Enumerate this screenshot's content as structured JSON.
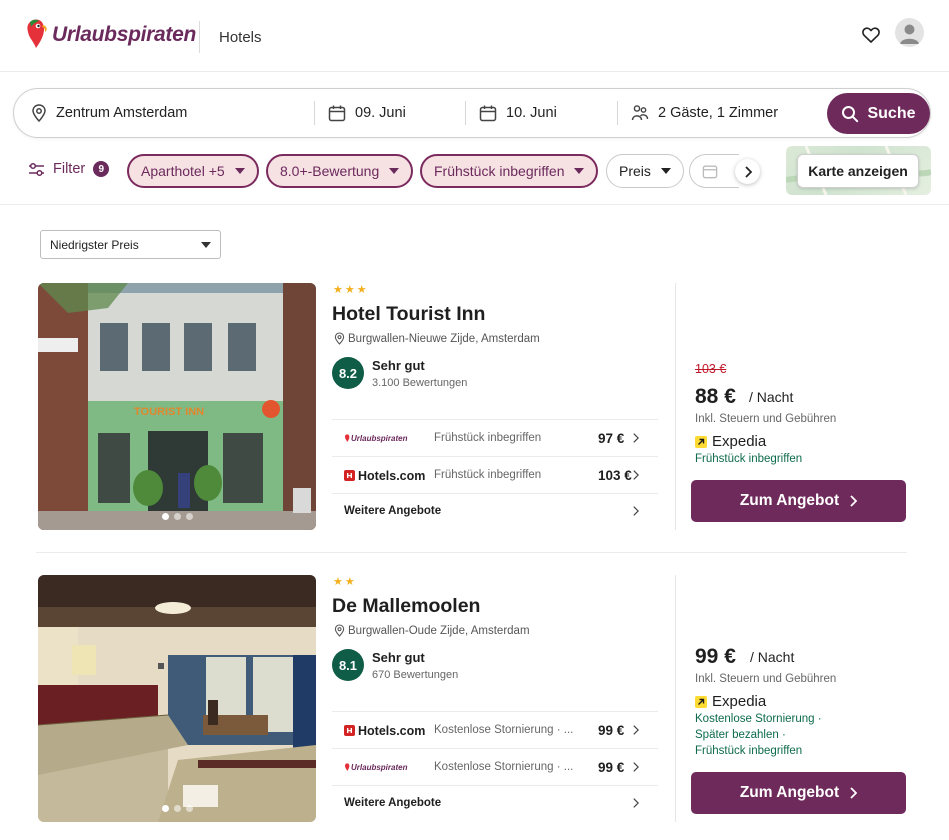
{
  "header": {
    "brand": "Urlaubspiraten",
    "nav_item": "Hotels",
    "favorites_icon": "heart-icon",
    "profile_icon": "user-avatar-icon"
  },
  "search": {
    "destination": "Zentrum Amsterdam",
    "checkin": "09. Juni",
    "checkout": "10. Juni",
    "guests": "2 Gäste, 1 Zimmer",
    "button_label": "Suche"
  },
  "filters": {
    "label": "Filter",
    "count": "9",
    "chips": [
      {
        "label": "Aparthotel +5",
        "active": true
      },
      {
        "label": "8.0+-Bewertung",
        "active": true
      },
      {
        "label": "Frühstück inbegriffen",
        "active": true
      },
      {
        "label": "Preis",
        "active": false
      }
    ],
    "map_button": "Karte anzeigen"
  },
  "sort": {
    "selected": "Niedrigster Preis"
  },
  "hotels": [
    {
      "stars": 3,
      "name": "Hotel Tourist Inn",
      "location": "Burgwallen-Nieuwe Zijde, Amsterdam",
      "rating": "8.2",
      "rating_label": "Sehr gut",
      "reviews": "3.100 Bewertungen",
      "offers": [
        {
          "partner": "Urlaubspiraten",
          "description": "Frühstück inbegriffen",
          "price": "97 €"
        },
        {
          "partner": "Hotels.com",
          "description": "Frühstück inbegriffen",
          "price": "103 €"
        }
      ],
      "more_offers": "Weitere Angebote",
      "old_price": "103 €",
      "price": "88 €",
      "per_night": "/ Nacht",
      "tax_note": "Inkl. Steuern und Gebühren",
      "provider": "Expedia",
      "perks": [
        "Frühstück inbegriffen"
      ],
      "cta": "Zum Angebot"
    },
    {
      "stars": 2,
      "name": "De Mallemoolen",
      "location": "Burgwallen-Oude Zijde, Amsterdam",
      "rating": "8.1",
      "rating_label": "Sehr gut",
      "reviews": "670 Bewertungen",
      "offers": [
        {
          "partner": "Hotels.com",
          "description": "Kostenlose Stornierung · ...",
          "price": "99 €"
        },
        {
          "partner": "Urlaubspiraten",
          "description": "Kostenlose Stornierung · ...",
          "price": "99 €"
        }
      ],
      "more_offers": "Weitere Angebote",
      "price": "99 €",
      "per_night": "/ Nacht",
      "tax_note": "Inkl. Steuern und Gebühren",
      "provider": "Expedia",
      "perks": [
        "Kostenlose Stornierung ·",
        "Später bezahlen ·",
        "Frühstück inbegriffen"
      ],
      "cta": "Zum Angebot"
    }
  ],
  "colors": {
    "brand": "#6f2a5c",
    "chip_bg": "#f6e1e3",
    "rating_green": "#0f5c47",
    "old_price_red": "#c0182b",
    "perk_green": "#0d6b4a",
    "star_yellow": "#f2b01e"
  }
}
